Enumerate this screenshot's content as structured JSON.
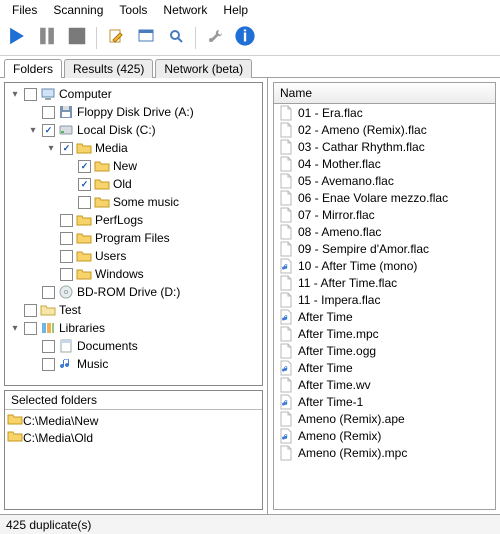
{
  "menu": [
    "Files",
    "Scanning",
    "Tools",
    "Network",
    "Help"
  ],
  "toolbar_icons": [
    "play",
    "pause",
    "stop",
    "sep",
    "edit",
    "window",
    "magnify",
    "sep",
    "tools",
    "info"
  ],
  "tabs": [
    {
      "label": "Folders",
      "active": true
    },
    {
      "label": "Results (425)",
      "active": false
    },
    {
      "label": "Network (beta)",
      "active": false
    }
  ],
  "tree": [
    {
      "indent": 0,
      "exp": "-",
      "checked": false,
      "icon": "computer",
      "label": "Computer"
    },
    {
      "indent": 1,
      "exp": "",
      "checked": false,
      "icon": "floppy",
      "label": "Floppy Disk Drive (A:)"
    },
    {
      "indent": 1,
      "exp": "-",
      "checked": true,
      "icon": "disk",
      "label": "Local Disk (C:)"
    },
    {
      "indent": 2,
      "exp": "-",
      "checked": true,
      "icon": "folder",
      "label": "Media"
    },
    {
      "indent": 3,
      "exp": "",
      "checked": true,
      "icon": "folder",
      "label": "New"
    },
    {
      "indent": 3,
      "exp": "",
      "checked": true,
      "icon": "folder",
      "label": "Old"
    },
    {
      "indent": 3,
      "exp": "",
      "checked": false,
      "icon": "folder",
      "label": "Some music"
    },
    {
      "indent": 2,
      "exp": "",
      "checked": false,
      "icon": "folder",
      "label": "PerfLogs"
    },
    {
      "indent": 2,
      "exp": "",
      "checked": false,
      "icon": "folder",
      "label": "Program Files"
    },
    {
      "indent": 2,
      "exp": "",
      "checked": false,
      "icon": "folder",
      "label": "Users"
    },
    {
      "indent": 2,
      "exp": "",
      "checked": false,
      "icon": "folder",
      "label": "Windows"
    },
    {
      "indent": 1,
      "exp": "",
      "checked": false,
      "icon": "dvd",
      "label": "BD-ROM Drive (D:)"
    },
    {
      "indent": 0,
      "exp": "",
      "checked": false,
      "icon": "folder-plain",
      "label": "Test"
    },
    {
      "indent": 0,
      "exp": "-",
      "checked": false,
      "icon": "libraries",
      "label": "Libraries"
    },
    {
      "indent": 1,
      "exp": "",
      "checked": false,
      "icon": "library",
      "label": "Documents"
    },
    {
      "indent": 1,
      "exp": "",
      "checked": false,
      "icon": "music-lib",
      "label": "Music"
    }
  ],
  "selected_folders_title": "Selected folders",
  "selected_folders": [
    "C:\\Media\\New",
    "C:\\Media\\Old"
  ],
  "list_header": "Name",
  "files": [
    {
      "icon": "file",
      "name": "01 - Era.flac"
    },
    {
      "icon": "file",
      "name": "02 - Ameno (Remix).flac"
    },
    {
      "icon": "file",
      "name": "03 - Cathar Rhythm.flac"
    },
    {
      "icon": "file",
      "name": "04 - Mother.flac"
    },
    {
      "icon": "file",
      "name": "05 - Avemano.flac"
    },
    {
      "icon": "file",
      "name": "06 - Enae Volare mezzo.flac"
    },
    {
      "icon": "file",
      "name": "07 - Mirror.flac"
    },
    {
      "icon": "file",
      "name": "08 - Ameno.flac"
    },
    {
      "icon": "file",
      "name": "09 - Sempire d'Amor.flac"
    },
    {
      "icon": "audio",
      "name": "10 - After Time (mono)"
    },
    {
      "icon": "file",
      "name": "11 - After Time.flac"
    },
    {
      "icon": "file",
      "name": "11 - Impera.flac"
    },
    {
      "icon": "audio",
      "name": "After Time"
    },
    {
      "icon": "file",
      "name": "After Time.mpc"
    },
    {
      "icon": "file",
      "name": "After Time.ogg"
    },
    {
      "icon": "audio",
      "name": "After Time"
    },
    {
      "icon": "file",
      "name": "After Time.wv"
    },
    {
      "icon": "audio",
      "name": "After Time-1"
    },
    {
      "icon": "file",
      "name": "Ameno (Remix).ape"
    },
    {
      "icon": "audio",
      "name": "Ameno (Remix)"
    },
    {
      "icon": "file",
      "name": "Ameno (Remix).mpc"
    }
  ],
  "status": "425 duplicate(s)"
}
